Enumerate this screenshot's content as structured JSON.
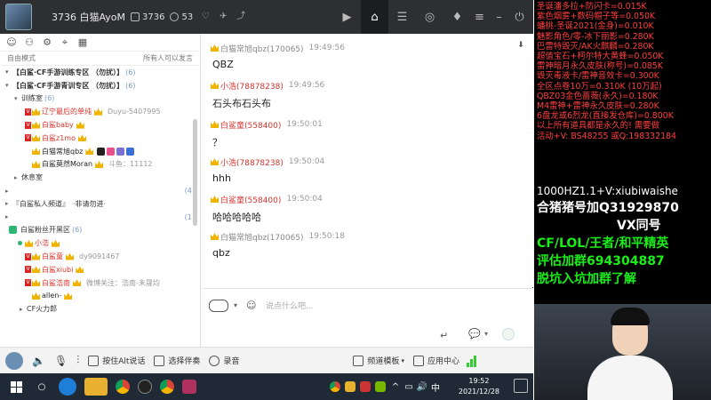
{
  "titlebar": {
    "channel": "3736 白猫AyoM",
    "channel_id": "3736",
    "online_count": "53"
  },
  "left": {
    "mode_label": "自由模式",
    "mode_hint": "所有人可以发言",
    "tree": [
      {
        "text": "【白鲨·CF手游训练专区 （勿扰）】",
        "count": "(6)"
      },
      {
        "text": "【白鲨·CF手游青训专区 （勿扰）】",
        "count": "(6)"
      },
      {
        "text": "训练室",
        "count": "(6)"
      },
      {
        "name": "辽宁最后的单纯",
        "extra": "Duyu-5407995"
      },
      {
        "name": "白鲨baby"
      },
      {
        "name": "白鲨z1mo"
      },
      {
        "name": "白猫常旭qbz"
      },
      {
        "name": "白鲨莫然Moran",
        "extra": "斗鱼：11112"
      },
      {
        "text": "休息室"
      },
      {
        "text": "",
        "count": "(4)"
      },
      {
        "text": "『白鲨私人频道』",
        "extra": "·非请勿进·"
      },
      {
        "text": "",
        "count": "(1)"
      },
      {
        "text": "白鲨粉丝开黑区",
        "count": "(6)"
      },
      {
        "name": "小浩"
      },
      {
        "name": "白鲨童",
        "extra": "dy9091467"
      },
      {
        "name": "白鲨xiubi"
      },
      {
        "name": "白鲨浩南",
        "extra": "微博关注：浩南-未晟均"
      },
      {
        "name": "allen-"
      },
      {
        "text": "CF火力郎"
      }
    ]
  },
  "chat": {
    "messages": [
      {
        "sender": "白猫常旭qbz(170065)",
        "time": "19:49:56",
        "text": "QBZ",
        "color": "#888888"
      },
      {
        "sender": "小浩(78878238)",
        "time": "19:49:56",
        "text": "石头布石头布",
        "color": "#d4342c"
      },
      {
        "sender": "白鲨童(558400)",
        "time": "19:50:01",
        "text": "？",
        "color": "#d4342c"
      },
      {
        "sender": "小浩(78878238)",
        "time": "19:50:04",
        "text": "hhh",
        "color": "#d4342c"
      },
      {
        "sender": "白鲨童(558400)",
        "time": "19:50:04",
        "text": "哈哈哈哈哈",
        "color": "#d4342c"
      },
      {
        "sender": "白猫常旭qbz(170065)",
        "time": "19:50:18",
        "text": "qbz",
        "color": "#888888"
      }
    ],
    "input_placeholder": "说点什么吧..."
  },
  "bottombar": {
    "alt_speak": "按住Alt说话",
    "accompany": "选择伴奏",
    "record": "录音",
    "template": "频道模板",
    "app_center": "应用中心"
  },
  "taskbar": {
    "time": "19:52",
    "date": "2021/12/28",
    "ime": "中"
  },
  "overlay": {
    "lines": [
      "圣诞潘多拉+防闪卡=0.015K",
      "紫色烟雾+数码帽子等=0.050K",
      "蟠桃-圣诞2021(金身)=0.010K",
      "魅影角色/零-冰下丽影=0.280K",
      "巴雷特毁灭/AK火麒麟=0.280K",
      "超值宝石+柯尔特大黄蜂=0.050K",
      "雷神暗月永久皮肤(称号)=0.085K",
      "毁灭毒液卡/雷神音效卡=0.300K",
      "全区点卷10万=0.310K (10万起)",
      "QBZ03金色蔷薇(永久)=0.180K",
      "M4雷神+雷神永久皮肤=0.280K",
      "6盘龙或6烈龙(直接发仓库)=0.800K",
      "以上所有道具都是永久的! 需要做",
      "活动+V: BS48255  或Q:198332184"
    ],
    "ad_line1": "1000HZ1.1+V:xiubiwaishe",
    "ad_line2": "合猪猪号加Q31929870",
    "ad_line3": "VX同号",
    "ad_line4": "CF/LOL/王者/和平精英",
    "ad_line5": "评估加群694304887",
    "ad_line6": "脱坑入坑加群了解"
  }
}
